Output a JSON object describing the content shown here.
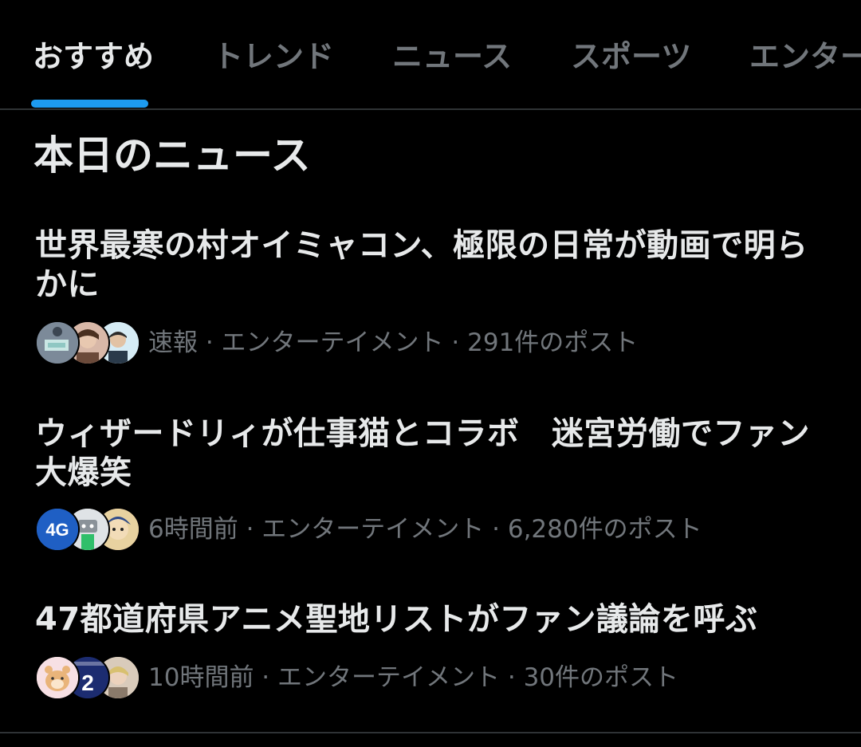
{
  "tabs": [
    {
      "label": "おすすめ",
      "active": true
    },
    {
      "label": "トレンド",
      "active": false
    },
    {
      "label": "ニュース",
      "active": false
    },
    {
      "label": "スポーツ",
      "active": false
    },
    {
      "label": "エンター",
      "active": false
    }
  ],
  "section": {
    "title": "本日のニュース"
  },
  "news": [
    {
      "headline": "世界最寒の村オイミャコン、極限の日常が動画で明らかに",
      "meta": "速報 · エンターテイメント · 291件のポスト",
      "avatars": [
        "news-thumbnail-avatar",
        "person-avatar",
        "person-avatar"
      ]
    },
    {
      "headline": "ウィザードリィが仕事猫とコラボ　迷宮労働でファン大爆笑",
      "meta": "6時間前 · エンターテイメント · 6,280件のポスト",
      "avatars": [
        "4g-logo-avatar",
        "robot-avatar",
        "character-avatar"
      ],
      "avatar_badge": "4G"
    },
    {
      "headline": "47都道府県アニメ聖地リストがファン議論を呼ぶ",
      "meta": "10時間前 · エンターテイメント · 30件のポスト",
      "avatars": [
        "hamster-avatar",
        "jersey-avatar",
        "person-avatar"
      ],
      "avatar_badge": "2"
    }
  ],
  "colors": {
    "background": "#000000",
    "text_primary": "#e7e9ea",
    "text_secondary": "#71767b",
    "accent": "#1d9bf0",
    "divider": "#2f3336"
  }
}
